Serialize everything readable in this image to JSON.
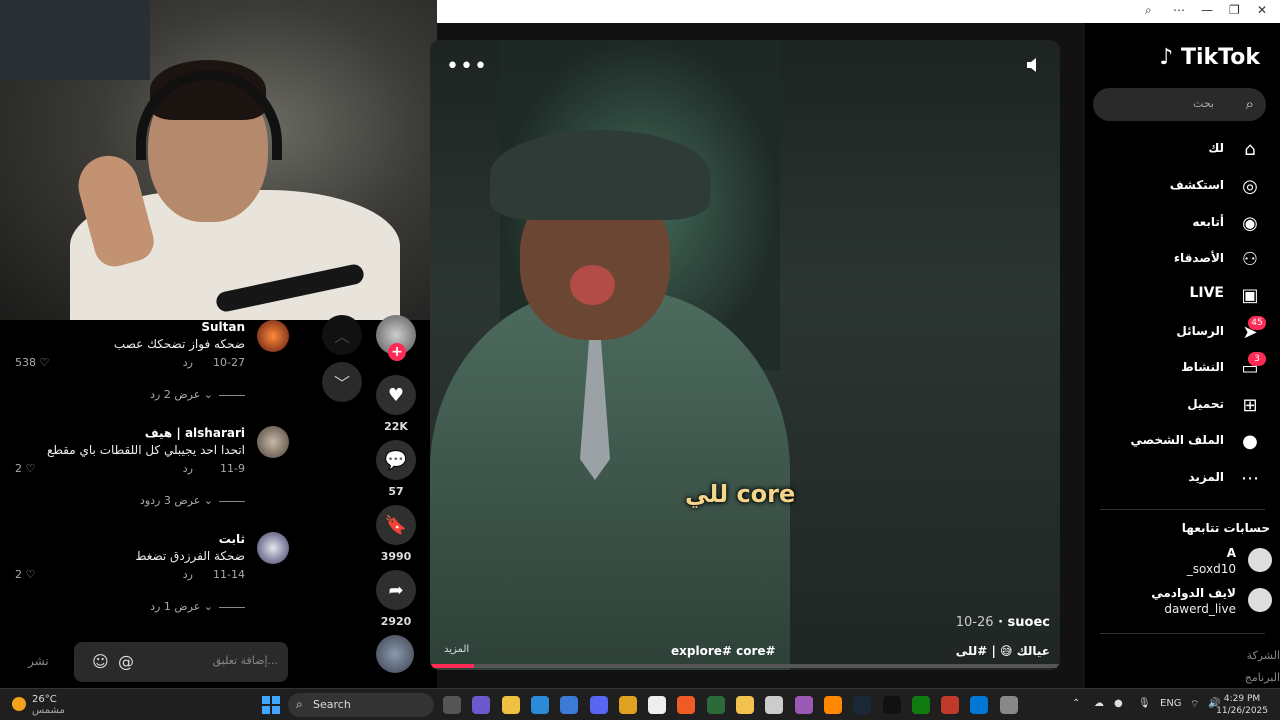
{
  "browser": {
    "zoom_icon": "zoom-icon",
    "more_icon": "more-icon",
    "minimize": "—",
    "restore": "❐",
    "close": "✕"
  },
  "video": {
    "caption": "للي core",
    "author": "suoec",
    "date": "10-26",
    "more_left": "المزيد",
    "tags": "explore# core#",
    "desc": "عيالك 😅 | #للى",
    "progress_fraction": 0.07
  },
  "actions": {
    "likes": "22K",
    "comments": "57",
    "saves": "3990",
    "shares": "2920"
  },
  "comments": [
    {
      "user": "Sultan",
      "text": "ضحكه فواز تضحكك عصب",
      "date": "10-27",
      "reply": "رد",
      "likes": "538",
      "view": "عرض 2 رد"
    },
    {
      "user": "هيف | alsharari",
      "text": "اتحدا احد يجيبلي كل اللقطات باي مقطع",
      "date": "11-9",
      "reply": "رد",
      "likes": "2",
      "view": "عرض 3 ردود"
    },
    {
      "user": "ثابت",
      "text": "ضحكة الفرزدق تضغط",
      "date": "11-14",
      "reply": "رد",
      "likes": "2",
      "view": "عرض 1 رد"
    }
  ],
  "comment_input": {
    "placeholder": "إضافة تعليق...",
    "post": "نشر"
  },
  "sidebar": {
    "logo": "TikTok",
    "search_placeholder": "بحث",
    "nav": [
      {
        "label": "لك",
        "icon": "home-icon"
      },
      {
        "label": "استكشف",
        "icon": "compass-icon"
      },
      {
        "label": "أتابعه",
        "icon": "following-icon"
      },
      {
        "label": "الأصدقاء",
        "icon": "friends-icon"
      },
      {
        "label": "LIVE",
        "icon": "live-icon"
      },
      {
        "label": "الرسائل",
        "icon": "messages-icon",
        "badge": "45"
      },
      {
        "label": "النشاط",
        "icon": "activity-icon",
        "badge": "3"
      },
      {
        "label": "تحميل",
        "icon": "upload-icon"
      },
      {
        "label": "الملف الشخصي",
        "icon": "profile-icon"
      },
      {
        "label": "المزيد",
        "icon": "more-dots-icon"
      }
    ],
    "following_title": "حسابات تتابعها",
    "following": [
      {
        "name": "A",
        "handle": "_soxd10"
      },
      {
        "name": "لايف الدوادمي",
        "handle": "dawerd_live"
      }
    ],
    "footer": [
      "الشركة",
      "البرنامج"
    ]
  },
  "taskbar": {
    "temp": "26°C",
    "condition": "مشمس",
    "search": "Search",
    "lang": "ENG",
    "time": "4:29 PM",
    "date": "11/26/2025"
  },
  "colors": {
    "accent": "#fe2c55",
    "caption": "#f5d58a",
    "start": "#3fa7ff"
  }
}
